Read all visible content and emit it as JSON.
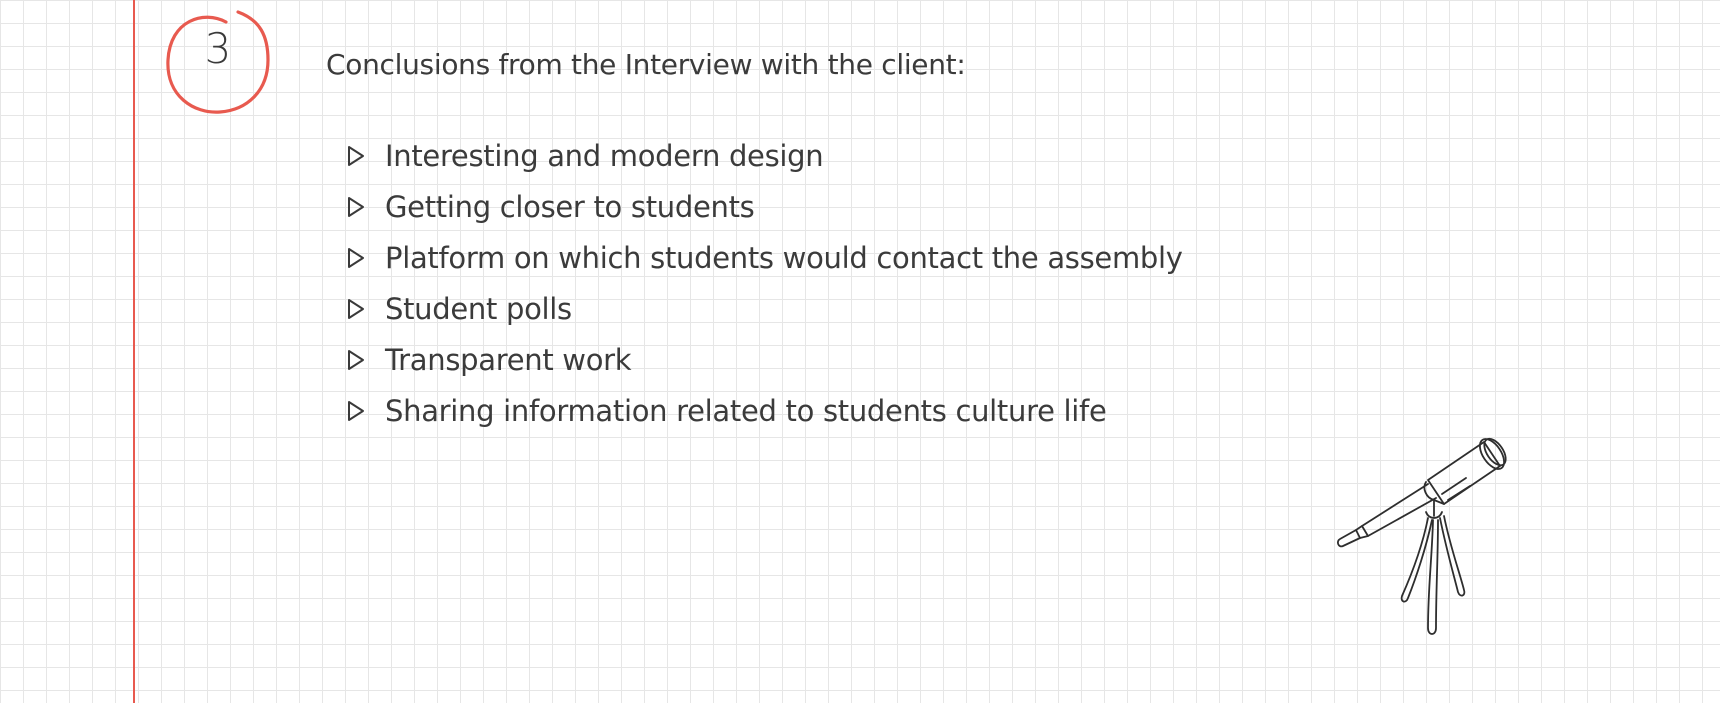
{
  "step": {
    "number": "3",
    "circle_color": "#e85a4f"
  },
  "margin_line_color": "#e85a4f",
  "title": "Conclusions from the Interview with the client:",
  "bullets": [
    {
      "text": "Interesting and modern design"
    },
    {
      "text": "Getting closer to students"
    },
    {
      "text": "Platform on which students would contact the assembly"
    },
    {
      "text": "Student polls"
    },
    {
      "text": "Transparent work"
    },
    {
      "text": "Sharing information related to students culture life"
    }
  ],
  "icons": {
    "bullet": "triangle-outline-icon",
    "illustration": "telescope-icon"
  }
}
